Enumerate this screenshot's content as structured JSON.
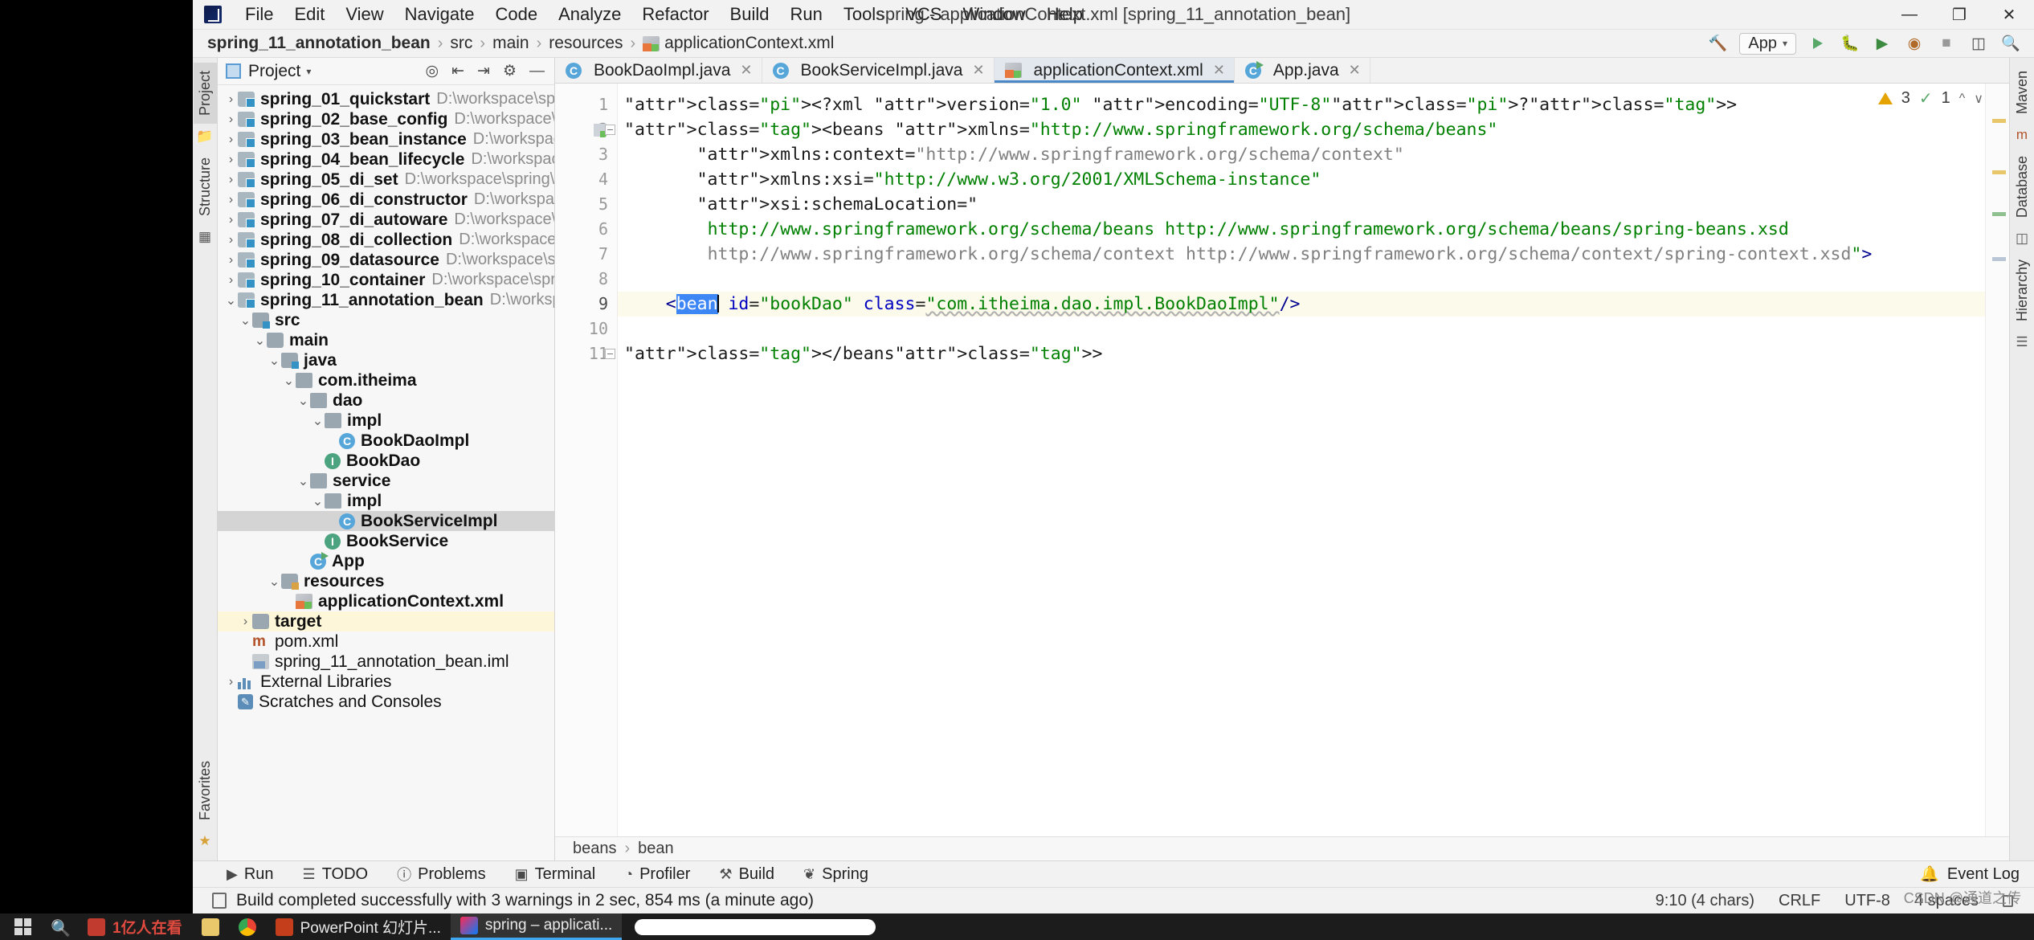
{
  "window": {
    "title": "spring - applicationContext.xml [spring_11_annotation_bean]",
    "minimize": "—",
    "maximize": "❐",
    "close": "✕"
  },
  "menubar": {
    "logo": "intellij-idea-logo",
    "items": [
      "File",
      "Edit",
      "View",
      "Navigate",
      "Code",
      "Analyze",
      "Refactor",
      "Build",
      "Run",
      "Tools",
      "VCS",
      "Window",
      "Help"
    ]
  },
  "navbar": {
    "crumbs": [
      "spring_11_annotation_bean",
      "src",
      "main",
      "resources",
      "applicationContext.xml"
    ],
    "separator": "›",
    "run_config": "App",
    "icons": [
      "hammer-icon",
      "run-icon",
      "debug-icon",
      "run-coverage-icon",
      "profiler-icon",
      "stop-icon",
      "search-everywhere-icon",
      "settings-icon"
    ]
  },
  "left_strip": {
    "tabs": [
      "Project",
      "Structure"
    ],
    "active": "Project",
    "bottom_tabs": [
      "Favorites"
    ]
  },
  "right_strip": {
    "tabs": [
      "Maven",
      "Database",
      "Hierarchy"
    ]
  },
  "project_panel": {
    "title": "Project",
    "caret": "▾",
    "head_icons": [
      "locate-icon",
      "expand-all-icon",
      "collapse-all-icon",
      "settings-icon",
      "hide-icon"
    ],
    "tree": [
      {
        "indent": 0,
        "arrow": "›",
        "icon": "module",
        "name": "spring_01_quickstart",
        "path": "D:\\workspace\\spring\\s",
        "state": "normal"
      },
      {
        "indent": 0,
        "arrow": "›",
        "icon": "module",
        "name": "spring_02_base_config",
        "path": "D:\\workspace\\spring",
        "state": "normal"
      },
      {
        "indent": 0,
        "arrow": "›",
        "icon": "module",
        "name": "spring_03_bean_instance",
        "path": "D:\\workspace\\spri",
        "state": "normal"
      },
      {
        "indent": 0,
        "arrow": "›",
        "icon": "module",
        "name": "spring_04_bean_lifecycle",
        "path": "D:\\workspace\\spri",
        "state": "normal"
      },
      {
        "indent": 0,
        "arrow": "›",
        "icon": "module",
        "name": "spring_05_di_set",
        "path": "D:\\workspace\\spring\\spri",
        "state": "normal"
      },
      {
        "indent": 0,
        "arrow": "›",
        "icon": "module",
        "name": "spring_06_di_constructor",
        "path": "D:\\workspace\\spr",
        "state": "normal"
      },
      {
        "indent": 0,
        "arrow": "›",
        "icon": "module",
        "name": "spring_07_di_autoware",
        "path": "D:\\workspace\\spring",
        "state": "normal"
      },
      {
        "indent": 0,
        "arrow": "›",
        "icon": "module",
        "name": "spring_08_di_collection",
        "path": "D:\\workspace\\spring",
        "state": "normal"
      },
      {
        "indent": 0,
        "arrow": "›",
        "icon": "module",
        "name": "spring_09_datasource",
        "path": "D:\\workspace\\spring\\",
        "state": "normal"
      },
      {
        "indent": 0,
        "arrow": "›",
        "icon": "module",
        "name": "spring_10_container",
        "path": "D:\\workspace\\spring\\s",
        "state": "normal"
      },
      {
        "indent": 0,
        "arrow": "⌄",
        "icon": "module",
        "name": "spring_11_annotation_bean",
        "path": "D:\\workspace\\",
        "state": "normal"
      },
      {
        "indent": 1,
        "arrow": "⌄",
        "icon": "folder-src",
        "name": "src",
        "path": "",
        "state": "normal"
      },
      {
        "indent": 2,
        "arrow": "⌄",
        "icon": "folder",
        "name": "main",
        "path": "",
        "state": "normal"
      },
      {
        "indent": 3,
        "arrow": "⌄",
        "icon": "folder-src",
        "name": "java",
        "path": "",
        "state": "normal"
      },
      {
        "indent": 4,
        "arrow": "⌄",
        "icon": "pkg",
        "name": "com.itheima",
        "path": "",
        "state": "normal"
      },
      {
        "indent": 5,
        "arrow": "⌄",
        "icon": "pkg",
        "name": "dao",
        "path": "",
        "state": "normal"
      },
      {
        "indent": 6,
        "arrow": "⌄",
        "icon": "pkg",
        "name": "impl",
        "path": "",
        "state": "normal"
      },
      {
        "indent": 7,
        "arrow": "",
        "icon": "class",
        "name": "BookDaoImpl",
        "path": "",
        "state": "normal"
      },
      {
        "indent": 6,
        "arrow": "",
        "icon": "interface",
        "name": "BookDao",
        "path": "",
        "state": "normal"
      },
      {
        "indent": 5,
        "arrow": "⌄",
        "icon": "pkg",
        "name": "service",
        "path": "",
        "state": "normal"
      },
      {
        "indent": 6,
        "arrow": "⌄",
        "icon": "pkg",
        "name": "impl",
        "path": "",
        "state": "normal"
      },
      {
        "indent": 7,
        "arrow": "",
        "icon": "class",
        "name": "BookServiceImpl",
        "path": "",
        "state": "selected"
      },
      {
        "indent": 6,
        "arrow": "",
        "icon": "interface",
        "name": "BookService",
        "path": "",
        "state": "normal"
      },
      {
        "indent": 5,
        "arrow": "",
        "icon": "app-class",
        "name": "App",
        "path": "",
        "state": "normal"
      },
      {
        "indent": 3,
        "arrow": "⌄",
        "icon": "folder-res",
        "name": "resources",
        "path": "",
        "state": "normal"
      },
      {
        "indent": 4,
        "arrow": "",
        "icon": "xml",
        "name": "applicationContext.xml",
        "path": "",
        "state": "normal"
      },
      {
        "indent": 1,
        "arrow": "›",
        "icon": "folder",
        "name": "target",
        "path": "",
        "state": "highlight"
      },
      {
        "indent": 1,
        "arrow": "",
        "icon": "maven",
        "name": "pom.xml",
        "path": "",
        "state": "plain"
      },
      {
        "indent": 1,
        "arrow": "",
        "icon": "iml",
        "name": "spring_11_annotation_bean.iml",
        "path": "",
        "state": "plain"
      },
      {
        "indent": 0,
        "arrow": "›",
        "icon": "library",
        "name": "External Libraries",
        "path": "",
        "state": "plain"
      },
      {
        "indent": 0,
        "arrow": "",
        "icon": "scratch",
        "name": "Scratches and Consoles",
        "path": "",
        "state": "plain"
      }
    ]
  },
  "editor": {
    "tabs": [
      {
        "label": "BookDaoImpl.java",
        "icon": "java-class-icon",
        "active": false,
        "close": "✕"
      },
      {
        "label": "BookServiceImpl.java",
        "icon": "java-class-icon",
        "active": false,
        "close": "✕"
      },
      {
        "label": "applicationContext.xml",
        "icon": "spring-xml-icon",
        "active": true,
        "close": "✕"
      },
      {
        "label": "App.java",
        "icon": "java-run-class-icon",
        "active": false,
        "close": "✕"
      }
    ],
    "line_numbers": [
      "1",
      "2",
      "3",
      "4",
      "5",
      "6",
      "7",
      "8",
      "9",
      "10",
      "11"
    ],
    "current_line": 9,
    "lines": [
      "<?xml version=\"1.0\" encoding=\"UTF-8\"?>",
      "<beans xmlns=\"http://www.springframework.org/schema/beans\"",
      "       xmlns:context=\"http://www.springframework.org/schema/context\"",
      "       xmlns:xsi=\"http://www.w3.org/2001/XMLSchema-instance\"",
      "       xsi:schemaLocation=\"",
      "        http://www.springframework.org/schema/beans http://www.springframework.org/schema/beans/spring-beans.xsd",
      "        http://www.springframework.org/schema/context http://www.springframework.org/schema/context/spring-context.xsd\">",
      "",
      "    <bean id=\"bookDao\" class=\"com.itheima.dao.impl.BookDaoImpl\"/>",
      "",
      "</beans>"
    ],
    "selection_text": "bean",
    "inspections": {
      "warning_count": "3",
      "checked": "1",
      "warning_icon": "warning-triangle-icon",
      "ok_icon": "inspection-ok-icon",
      "up": "⌃",
      "down": "⌄"
    },
    "breadcrumb": [
      "beans",
      "bean"
    ],
    "breadcrumb_separator": "›"
  },
  "bottom_toolwindows": {
    "items": [
      {
        "label": "Run",
        "icon": "run-icon"
      },
      {
        "label": "TODO",
        "icon": "todo-icon"
      },
      {
        "label": "Problems",
        "icon": "problems-icon"
      },
      {
        "label": "Terminal",
        "icon": "terminal-icon"
      },
      {
        "label": "Profiler",
        "icon": "profiler-icon"
      },
      {
        "label": "Build",
        "icon": "build-icon"
      },
      {
        "label": "Spring",
        "icon": "spring-leaf-icon"
      }
    ],
    "event_log": "Event Log"
  },
  "statusbar": {
    "icon": "build-status-icon",
    "message": "Build completed successfully with 3 warnings in 2 sec, 854 ms (a minute ago)",
    "position": "9:10 (4 chars)",
    "line_separator": "CRLF",
    "encoding": "UTF-8",
    "indent": "4 spaces",
    "lock_icon": "lock-icon"
  },
  "taskbar": {
    "start": "windows-start-icon",
    "pinned": [
      "search-icon",
      "wechat-icon",
      "explorer-icon",
      "chrome-icon"
    ],
    "items": [
      {
        "label": "PowerPoint 幻灯片...",
        "icon": "powerpoint-icon",
        "active": false
      },
      {
        "label": "spring – applicati...",
        "icon": "intellij-icon",
        "active": true
      }
    ],
    "cn_label": "1亿人在看"
  },
  "watermark": "CSDN @通道之传",
  "colors": {
    "accent": "#4a88c7",
    "green": "#59a869",
    "warning": "#e5a300",
    "selection": "#3d86f5",
    "current_line": "#fcfaeb",
    "tab_active": "#e2e8ee"
  }
}
